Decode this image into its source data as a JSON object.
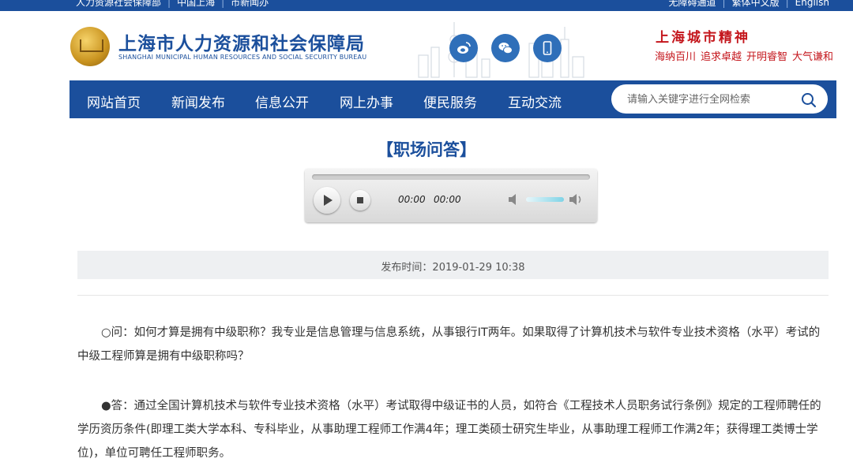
{
  "topbar": {
    "left_links": [
      "人力资源社会保障部",
      "中国上海",
      "市新闻办"
    ],
    "right_links": [
      "无障碍通道",
      "繁体中文版",
      "English"
    ]
  },
  "header": {
    "title_cn": "上海市人力资源和社会保障局",
    "title_en": "SHANGHAI MUNICIPAL HUMAN RESOURCES AND SOCIAL SECURITY BUREAU",
    "social_icons": [
      "weibo-icon",
      "wechat-icon",
      "mobile-icon"
    ],
    "spirit_title": "上海城市精神",
    "spirit_mottos": [
      "海纳百川",
      "追求卓越",
      "开明睿智",
      "大气谦和"
    ]
  },
  "nav": {
    "items": [
      "网站首页",
      "新闻发布",
      "信息公开",
      "网上办事",
      "便民服务",
      "互动交流"
    ],
    "search_placeholder": "请输入关键字进行全网检索"
  },
  "article": {
    "title": "【职场问答】",
    "player": {
      "current_time": "00:00",
      "duration": "00:00"
    },
    "publish_label": "发布时间：2019-01-29 10:38",
    "question": "○问：如何才算是拥有中级职称？我专业是信息管理与信息系统，从事银行IT两年。如果取得了计算机技术与软件专业技术资格（水平）考试的中级工程师算是拥有中级职称吗？",
    "answer": "●答：通过全国计算机技术与软件专业技术资格（水平）考试取得中级证书的人员，如符合《工程技术人员职务试行条例》规定的工程师聘任的学历资历条件(即理工类大学本科、专科毕业，从事助理工程师工作满4年；理工类硕士研究生毕业，从事助理工程师工作满2年；获得理工类博士学位)，单位可聘任工程师职务。"
  },
  "colors": {
    "brand_blue": "#1b4f9c",
    "spirit_red": "#c4161c"
  }
}
